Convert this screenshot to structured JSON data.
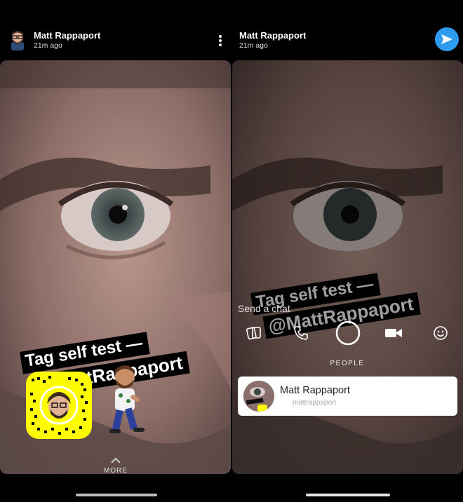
{
  "left": {
    "header": {
      "name": "Matt Rappaport",
      "time": "21m ago"
    },
    "caption": {
      "line1": "Tag self test —",
      "line2": "@MattRappaport"
    },
    "more_label": "MORE"
  },
  "right": {
    "header": {
      "name": "Matt Rappaport",
      "time": "21m ago"
    },
    "chat_placeholder": "Send a chat",
    "caption": {
      "line1": "Tag self test —",
      "line2": "@MattRappaport"
    },
    "people_label": "PEOPLE",
    "people": [
      {
        "name": "Matt Rappaport",
        "username": "mattrappaport"
      }
    ]
  },
  "colors": {
    "send_button": "#2d9bf0",
    "snapcode": "#fffc00",
    "background": "#000000"
  }
}
